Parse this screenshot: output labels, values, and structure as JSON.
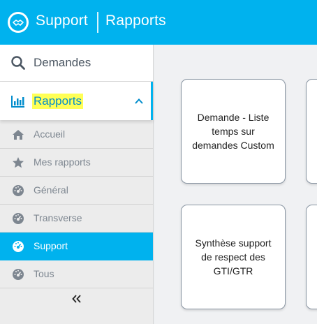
{
  "header": {
    "app_title": "Support",
    "page_title": "Rapports",
    "logo_icon": "support-handshake-logo",
    "color": "#00b2ee"
  },
  "sidebar": {
    "main_items": [
      {
        "label": "Demandes",
        "icon": "search-icon"
      },
      {
        "label": "Rapports",
        "icon": "bar-chart-icon",
        "expanded": true
      }
    ],
    "sub_items": [
      {
        "label": "Accueil",
        "icon": "home-icon",
        "active": false
      },
      {
        "label": "Mes rapports",
        "icon": "star-icon",
        "active": false
      },
      {
        "label": "Général",
        "icon": "dashboard-icon",
        "active": false
      },
      {
        "label": "Transverse",
        "icon": "dashboard-icon",
        "active": false
      },
      {
        "label": "Support",
        "icon": "dashboard-icon",
        "active": true
      },
      {
        "label": "Tous",
        "icon": "dashboard-icon",
        "active": false
      }
    ],
    "collapse_label": "«"
  },
  "main": {
    "cards": [
      {
        "label": "Demande - Liste temps sur demandes Custom"
      },
      {
        "label": ""
      },
      {
        "label": "Synthèse support de respect des GTI/GTR"
      },
      {
        "label": ""
      }
    ]
  }
}
